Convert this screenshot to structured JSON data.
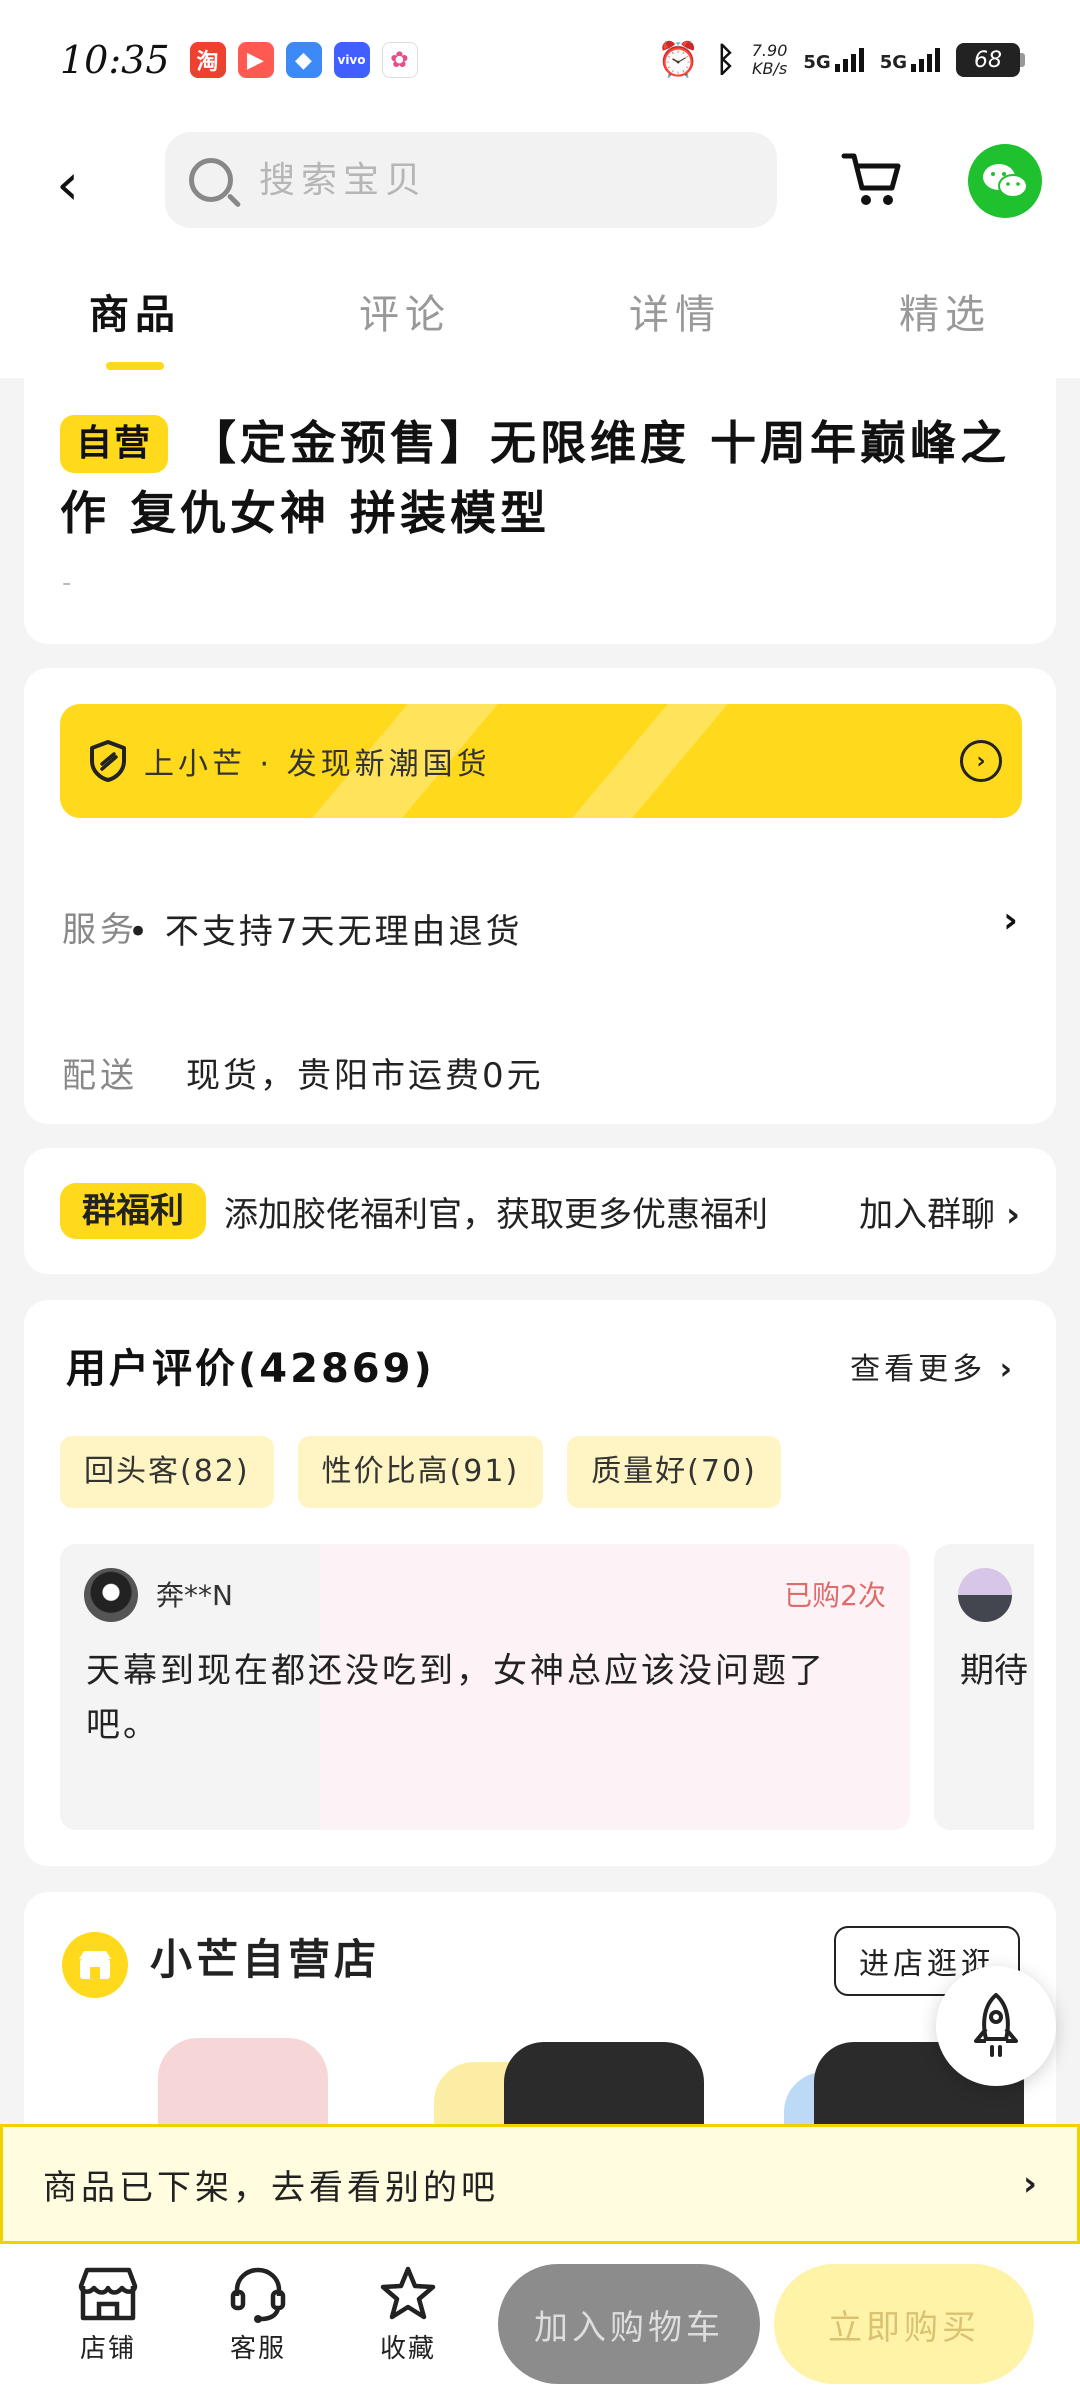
{
  "status_bar": {
    "time": "10:35",
    "speed_value": "7.90",
    "speed_unit": "KB/s",
    "network_1": "5G",
    "network_2": "5G",
    "battery": "68",
    "app_icons": [
      "taobao-app-icon",
      "video-app-icon",
      "browser-app-icon",
      "vivo-app-icon",
      "assistant-app-icon"
    ]
  },
  "header": {
    "search_placeholder": "搜索宝贝"
  },
  "tabs": [
    "商品",
    "评论",
    "详情",
    "精选"
  ],
  "product": {
    "badge": "自营",
    "title": "【定金预售】无限维度 十周年巅峰之作 复仇女神 拼装模型",
    "subtitle": "-"
  },
  "service": {
    "promo_text": "上小芒 · 发现新潮国货",
    "service_label": "服务",
    "service_value": "• 不支持7天无理由退货",
    "delivery_label": "配送",
    "delivery_value": "现货，贵阳市运费0元"
  },
  "group": {
    "badge": "群福利",
    "text": "添加胶佬福利官，获取更多优惠福利",
    "join": "加入群聊"
  },
  "reviews": {
    "title": "用户评价(42869)",
    "more": "查看更多",
    "tags": [
      "回头客(82)",
      "性价比高(91)",
      "质量好(70)"
    ],
    "items": [
      {
        "user": "奔**N",
        "badge": "已购2次",
        "text": "天幕到现在都还没吃到，女神总应该没问题了吧。"
      },
      {
        "text": "期待"
      }
    ]
  },
  "store": {
    "name": "小芒自营店",
    "button": "进店逛逛"
  },
  "notice": {
    "text": "商品已下架，去看看别的吧"
  },
  "bottom_bar": {
    "shop": "店铺",
    "service": "客服",
    "favorite": "收藏",
    "add_cart": "加入购物车",
    "buy_now": "立即购买"
  },
  "colors": {
    "brand_yellow": "#ffd91b",
    "wechat_green": "#1fc12e",
    "repurchase_red": "#e06b6b"
  }
}
